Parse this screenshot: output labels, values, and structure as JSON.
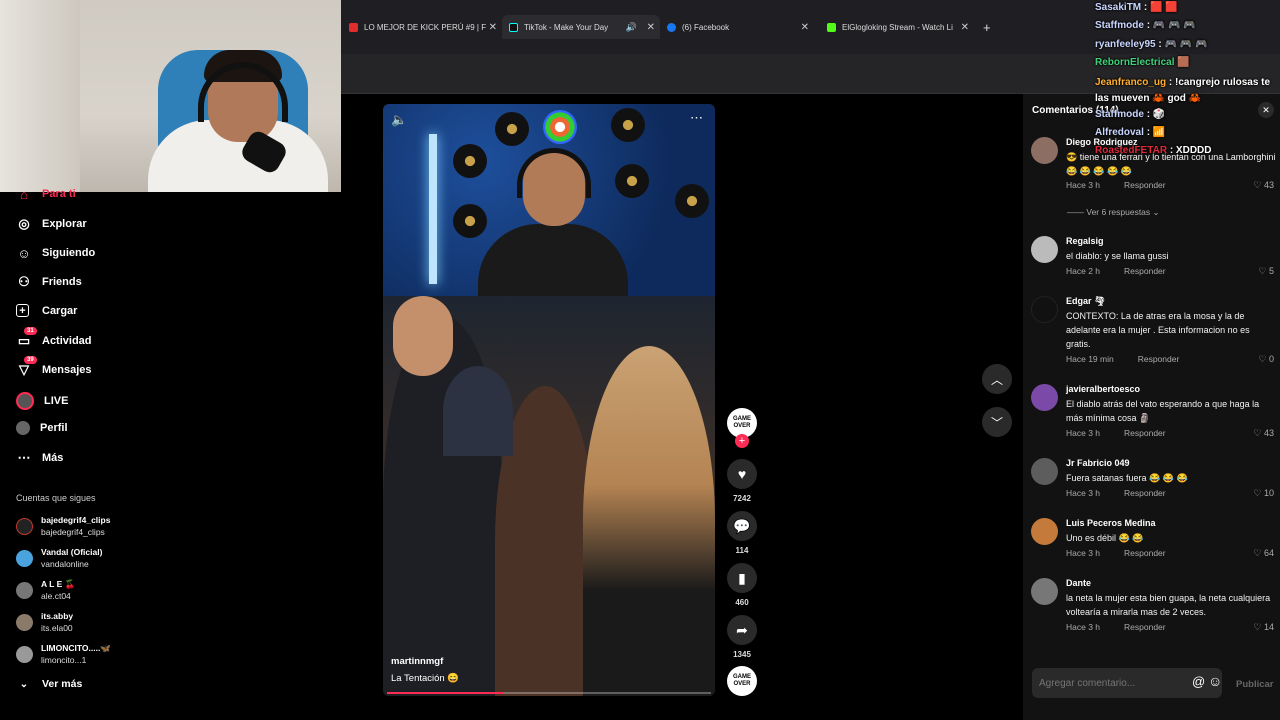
{
  "tabs": [
    {
      "label": "LO MEJOR DE KICK PERÚ #9 | F",
      "favicon": "#e12d2d"
    },
    {
      "label": "TikTok - Make Your Day",
      "favicon": "#111"
    },
    {
      "label": "(6) Facebook",
      "favicon": "#1877f2"
    },
    {
      "label": "ElGlogloking Stream - Watch Li",
      "favicon": "#53fc18"
    }
  ],
  "new_tab": "+",
  "nav": {
    "items": [
      {
        "label": "Para ti",
        "icon": "home-icon"
      },
      {
        "label": "Explorar",
        "icon": "compass-icon"
      },
      {
        "label": "Siguiendo",
        "icon": "following-icon"
      },
      {
        "label": "Friends",
        "icon": "friends-icon"
      },
      {
        "label": "Cargar",
        "icon": "upload-icon"
      },
      {
        "label": "Actividad",
        "icon": "activity-icon",
        "badge": "31"
      },
      {
        "label": "Mensajes",
        "icon": "messages-icon",
        "badge": "39"
      },
      {
        "label": "LIVE",
        "icon": "live-icon"
      },
      {
        "label": "Perfil",
        "icon": "profile-icon"
      },
      {
        "label": "Más",
        "icon": "more-icon"
      }
    ],
    "following_title": "Cuentas que sigues",
    "accounts": [
      {
        "name": "bajedegrif4_clips",
        "handle": "bajedegrif4_clips",
        "color": "#c0392b"
      },
      {
        "name": "Vandal (Oficial)",
        "handle": "vandalonline",
        "color": "#4aa3df"
      },
      {
        "name": "A L E 🍒",
        "handle": "ale.ct04",
        "color": "#777"
      },
      {
        "name": "its.abby",
        "handle": "its.ela00",
        "color": "#8a7a6a"
      },
      {
        "name": "LIMONCITO.....🦋",
        "handle": "limoncito...1",
        "color": "#999"
      }
    ],
    "see_more": "Ver más"
  },
  "video": {
    "username": "martinnmgf",
    "caption": "La Tentación 😄",
    "progress": 0.36
  },
  "actions": {
    "creator_label": "GAME OVER",
    "likes": "7242",
    "comments": "114",
    "saves": "460",
    "shares": "1345"
  },
  "comments_panel": {
    "title": "Comentarios (114)",
    "see_replies": "Ver 6 respuestas",
    "input_placeholder": "Agregar comentario...",
    "publish": "Publicar",
    "reply_label": "Responder",
    "items": [
      {
        "user": "Diego Rodriguez",
        "text": "😎 tiene una ferrari y lo tientan con una Lamborghini 😂 😂 😂 😂 😂",
        "time": "Hace 3 h",
        "likes": "43",
        "color": "#8d6e63"
      },
      {
        "user": "Regalsig",
        "text": "el diablo: y se llama gussi",
        "time": "Hace 2 h",
        "likes": "5",
        "color": "#bbb"
      },
      {
        "user": "Edgar 🌪",
        "text": "CONTEXTO: La de atras era la mosa y la de adelante era la mujer . Esta informacion no es gratis.",
        "time": "Hace 19 min",
        "likes": "0",
        "color": "#111"
      },
      {
        "user": "javieralbertoesco",
        "text": "El diablo atrás del vato esperando a que haga la más mínima cosa 🗿",
        "time": "Hace 3 h",
        "likes": "43",
        "color": "#7b4aa8"
      },
      {
        "user": "Jr Fabricio 049",
        "text": "Fuera satanas fuera 😂 😂 😂",
        "time": "Hace 3 h",
        "likes": "10",
        "color": "#5d5d5d"
      },
      {
        "user": "Luis Peceros Medina",
        "text": "Uno es débil 😂 😂",
        "time": "Hace 3 h",
        "likes": "64",
        "color": "#c47a3a"
      },
      {
        "user": "Dante",
        "text": "la neta la mujer esta bien guapa, la neta cualquiera voltearía a mirarla mas de 2 veces.",
        "time": "Hace 3 h",
        "likes": "14",
        "color": "#777"
      }
    ]
  },
  "chat": [
    {
      "user": "SasakiTM",
      "msg": ": 🟥 🟥",
      "color": "#c9d6ff"
    },
    {
      "user": "Staffmode",
      "msg": ": 🎮 🎮 🎮",
      "color": "#c9d6ff"
    },
    {
      "user": "ryanfeeley95",
      "msg": ": 🎮 🎮 🎮",
      "color": "#c9d6ff"
    },
    {
      "user": "RebornElectrical",
      "msg": "🟫",
      "color": "#3fd17a"
    },
    {
      "user": "Jeanfranco_ug",
      "msg": ": !cangrejo rulosas te las mueven 🦀 god 🦀",
      "color": "#ffb02e"
    },
    {
      "user": "Staffmode",
      "msg": ": 🎲",
      "color": "#c9d6ff"
    },
    {
      "user": "Alfredoval",
      "msg": ": 📶",
      "color": "#c9d6ff"
    },
    {
      "user": "RoastedFETAR",
      "msg": ": XDDDD",
      "color": "#e0283b"
    }
  ]
}
